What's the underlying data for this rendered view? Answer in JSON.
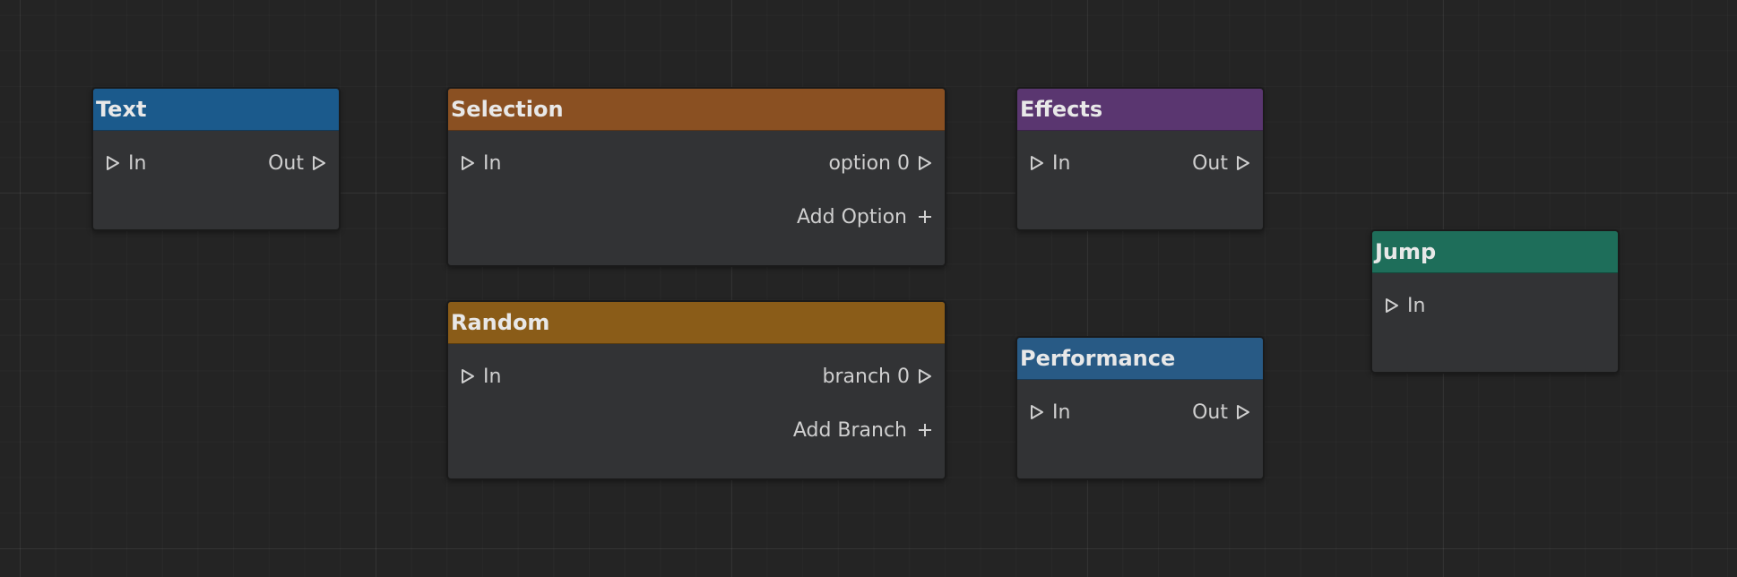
{
  "nodes": {
    "text": {
      "title": "Text",
      "header_color": "#1b5a8c",
      "input_label": "In",
      "output_label": "Out"
    },
    "selection": {
      "title": "Selection",
      "header_color": "#8a5022",
      "input_label": "In",
      "output_label": "option 0",
      "add_label": "Add Option"
    },
    "effects": {
      "title": "Effects",
      "header_color": "#5a3670",
      "input_label": "In",
      "output_label": "Out"
    },
    "jump": {
      "title": "Jump",
      "header_color": "#1e6e5a",
      "input_label": "In"
    },
    "random": {
      "title": "Random",
      "header_color": "#8a5c18",
      "input_label": "In",
      "output_label": "branch 0",
      "add_label": "Add Branch"
    },
    "performance": {
      "title": "Performance",
      "header_color": "#285a85",
      "input_label": "In",
      "output_label": "Out"
    }
  },
  "icons": {
    "port": "port-triangle-icon",
    "add": "plus-icon"
  }
}
